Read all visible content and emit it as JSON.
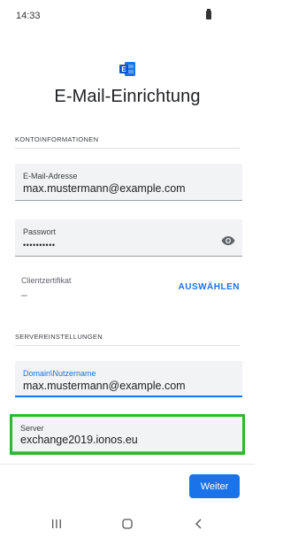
{
  "status": {
    "time": "14:33"
  },
  "header": {
    "title": "E-Mail-Einrichtung"
  },
  "account_section": {
    "header": "KONTOINFORMATIONEN",
    "email": {
      "label": "E-Mail-Adresse",
      "value": "max.mustermann@example.com"
    },
    "password": {
      "label": "Passwort",
      "value": "••••••••••"
    },
    "certificate": {
      "label": "Clientzertifikat",
      "value": "–",
      "action": "AUSWÄHLEN"
    }
  },
  "server_section": {
    "header": "SERVEREINSTELLUNGEN",
    "domain_user": {
      "label": "Domain\\Nutzername",
      "value": "max.mustermann@example.com"
    },
    "server": {
      "label": "Server",
      "value": "exchange2019.ionos.eu"
    }
  },
  "footer": {
    "next_label": "Weiter"
  },
  "colors": {
    "accent": "#1a73e8",
    "highlight": "#2db82d"
  },
  "icons": [
    "outlook-logo-icon",
    "eye-icon",
    "recents-icon",
    "home-icon",
    "back-icon"
  ]
}
